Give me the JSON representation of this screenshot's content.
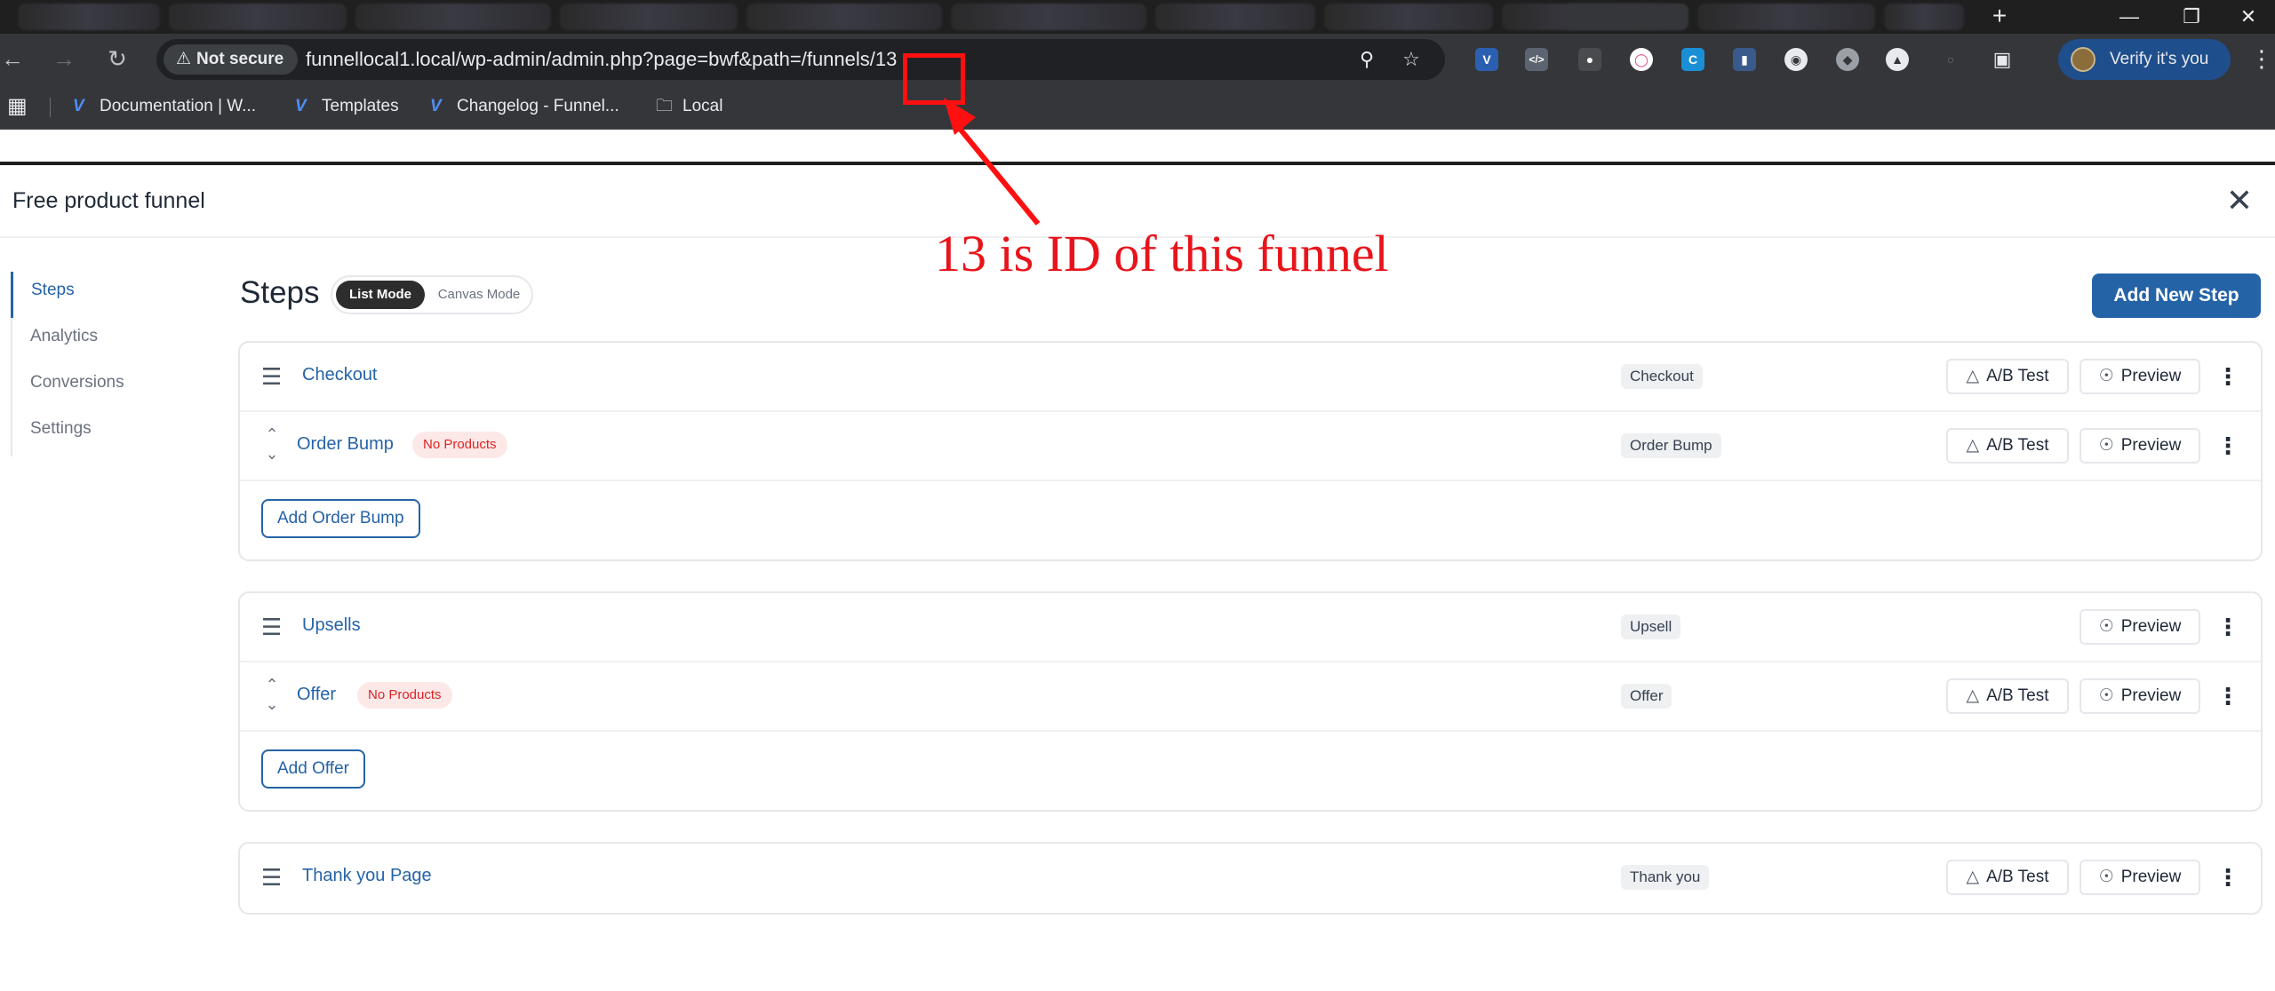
{
  "browser": {
    "security_label": "Not secure",
    "url": "funnellocal1.local/wp-admin/admin.php?page=bwf&path=/funnels/13",
    "new_tab_label": "+",
    "verify_label": "Verify it's you",
    "bookmarks": [
      {
        "label": "Documentation | W...",
        "icon": "funnelkit-icon"
      },
      {
        "label": "Templates",
        "icon": "funnelkit-icon"
      },
      {
        "label": "Changelog - Funnel...",
        "icon": "funnelkit-icon"
      },
      {
        "label": "Local",
        "icon": "folder-icon"
      }
    ]
  },
  "app": {
    "title": "Free product funnel",
    "sidebar": [
      {
        "label": "Steps",
        "active": true
      },
      {
        "label": "Analytics",
        "active": false
      },
      {
        "label": "Conversions",
        "active": false
      },
      {
        "label": "Settings",
        "active": false
      }
    ],
    "steps_heading": "Steps",
    "modes": {
      "list": "List Mode",
      "canvas": "Canvas Mode"
    },
    "add_step_label": "Add New Step",
    "ab_test_label": "A/B Test",
    "preview_label": "Preview",
    "groups": [
      {
        "rows": [
          {
            "name": "Checkout",
            "type": "Checkout",
            "badge": "",
            "ab_test": true
          },
          {
            "name": "Order Bump",
            "type": "Order Bump",
            "badge": "No Products",
            "ab_test": true
          }
        ],
        "add_label": "Add Order Bump"
      },
      {
        "rows": [
          {
            "name": "Upsells",
            "type": "Upsell",
            "badge": "",
            "ab_test": false
          },
          {
            "name": "Offer",
            "type": "Offer",
            "badge": "No Products",
            "ab_test": true
          }
        ],
        "add_label": "Add Offer"
      },
      {
        "rows": [
          {
            "name": "Thank you Page",
            "type": "Thank you",
            "badge": "",
            "ab_test": true
          }
        ],
        "add_label": ""
      }
    ]
  },
  "annotation": {
    "text": "13 is ID of this funnel",
    "color": "#e8141b"
  }
}
